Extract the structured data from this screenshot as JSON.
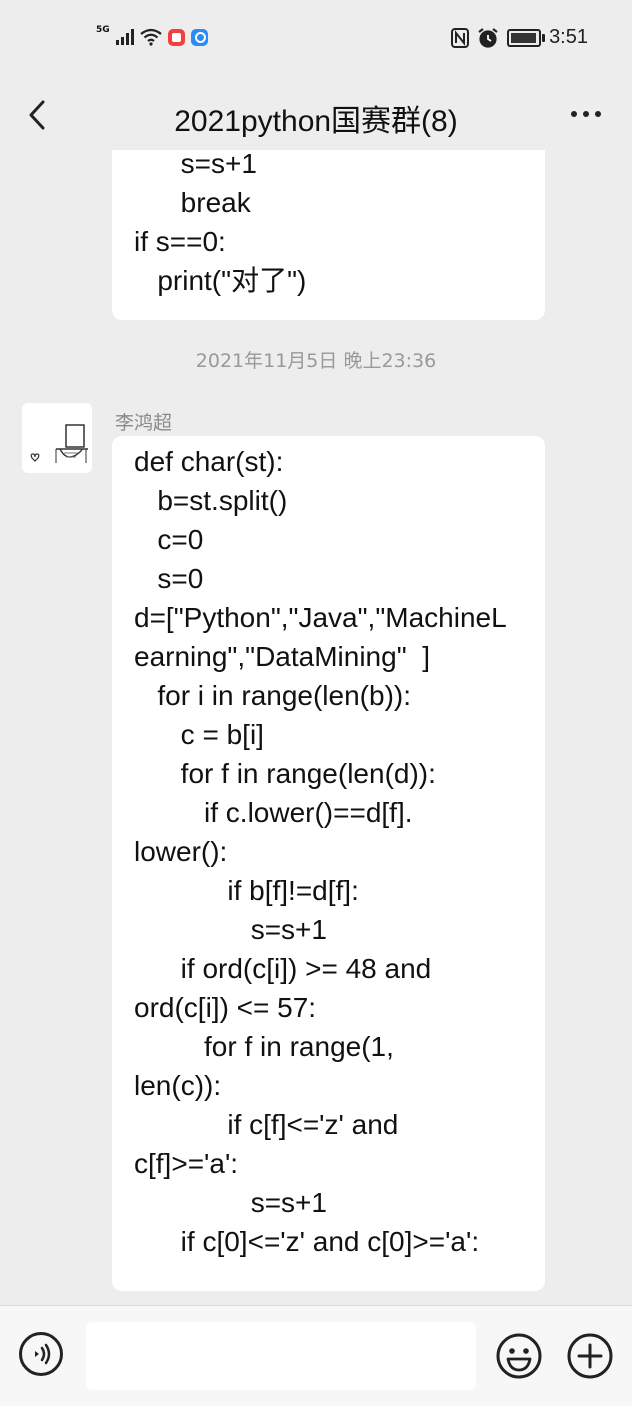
{
  "status_bar": {
    "network": "5G",
    "time": "3:51",
    "icons": [
      "signal-icon",
      "wifi-icon",
      "red-app-icon",
      "blue-app-icon",
      "nfc-icon",
      "alarm-icon",
      "battery-icon"
    ]
  },
  "header": {
    "title": "2021python国赛群(8)",
    "back_icon": "back-chevron-icon",
    "more_icon": "more-dots-icon"
  },
  "messages": [
    {
      "type": "text",
      "lines": [
        "      s=s+1",
        "      break",
        "if s==0:",
        "   print(\"对了\")"
      ]
    },
    {
      "type": "timestamp",
      "text": "2021年11月5日 晚上23:36"
    },
    {
      "type": "text",
      "sender": "李鸿超",
      "lines": [
        "def char(st):",
        "   b=st.split()",
        "   c=0",
        "   s=0",
        "",
        "d=[\"Python\",\"Java\",\"MachineL",
        "earning\",\"DataMining\"  ]",
        "   for i in range(len(b)):",
        "      c = b[i]",
        "      for f in range(len(d)):",
        "         if c.lower()==d[f].",
        "lower():",
        "            if b[f]!=d[f]:",
        "               s=s+1",
        "      if ord(c[i]) >= 48 and",
        "ord(c[i]) <= 57:",
        "         for f in range(1,",
        "len(c)):",
        "            if c[f]<='z' and",
        "c[f]>='a':",
        "               s=s+1",
        "      if c[0]<='z' and c[0]>='a':"
      ]
    }
  ],
  "input_bar": {
    "voice_icon": "voice-icon",
    "emoji_icon": "emoji-icon",
    "plus_icon": "plus-icon",
    "placeholder": ""
  }
}
